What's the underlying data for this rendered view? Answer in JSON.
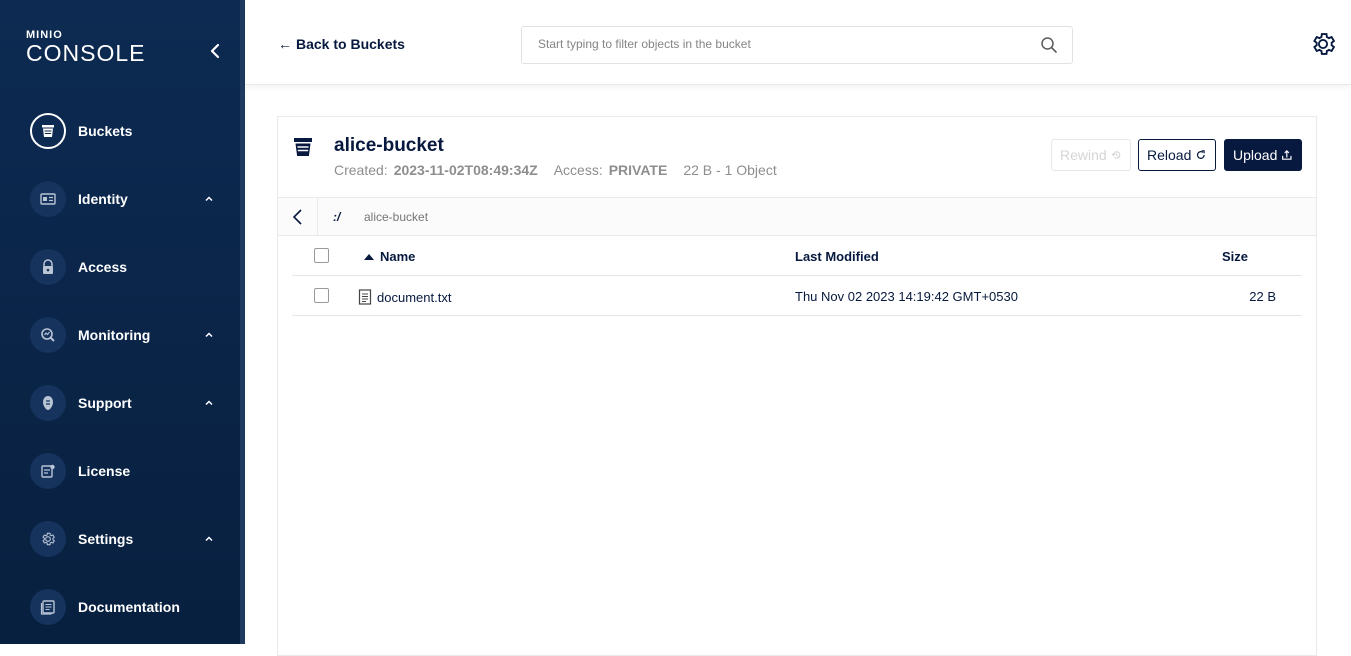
{
  "sidebar": {
    "logo_top": "MINIO",
    "logo_bottom": "CONSOLE",
    "items": [
      {
        "label": "Buckets",
        "icon": "bucket-icon",
        "expandable": false,
        "active": true
      },
      {
        "label": "Identity",
        "icon": "id-card-icon",
        "expandable": true
      },
      {
        "label": "Access",
        "icon": "lock-icon",
        "expandable": false
      },
      {
        "label": "Monitoring",
        "icon": "monitoring-icon",
        "expandable": true
      },
      {
        "label": "Support",
        "icon": "support-icon",
        "expandable": true
      },
      {
        "label": "License",
        "icon": "license-icon",
        "expandable": false
      },
      {
        "label": "Settings",
        "icon": "gear-icon",
        "expandable": true
      },
      {
        "label": "Documentation",
        "icon": "documentation-icon",
        "expandable": false
      }
    ]
  },
  "header": {
    "back_label": "Back to Buckets",
    "search_placeholder": "Start typing to filter objects in the bucket"
  },
  "bucket": {
    "name": "alice-bucket",
    "created_label": "Created:",
    "created_value": "2023-11-02T08:49:34Z",
    "access_label": "Access:",
    "access_value": "PRIVATE",
    "summary": "22 B - 1 Object",
    "rewind_label": "Rewind",
    "reload_label": "Reload",
    "upload_label": "Upload"
  },
  "breadcrumb": {
    "root": ":/",
    "current": "alice-bucket"
  },
  "table": {
    "columns": [
      "Name",
      "Last Modified",
      "Size"
    ],
    "rows": [
      {
        "name": "document.txt",
        "modified": "Thu Nov 02 2023 14:19:42 GMT+0530",
        "size": "22 B"
      }
    ]
  },
  "colors": {
    "sidebar_bg": "#0d2a52",
    "primary": "#07193e",
    "muted": "#8e8e8e"
  }
}
